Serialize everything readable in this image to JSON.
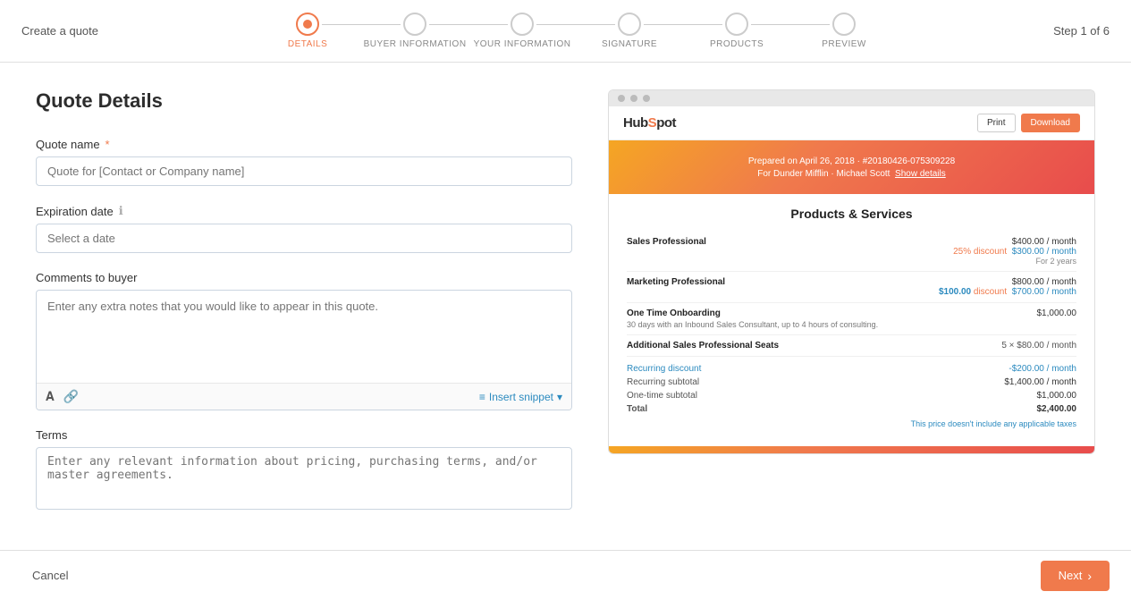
{
  "header": {
    "create_quote_label": "Create a quote",
    "step_info": "Step 1 of 6",
    "steps": [
      {
        "id": "details",
        "label": "DETAILS",
        "active": true
      },
      {
        "id": "buyer-information",
        "label": "BUYER INFORMATION",
        "active": false
      },
      {
        "id": "your-information",
        "label": "YOUR INFORMATION",
        "active": false
      },
      {
        "id": "signature",
        "label": "SIGNATURE",
        "active": false
      },
      {
        "id": "products",
        "label": "PRODUCTS",
        "active": false
      },
      {
        "id": "preview",
        "label": "PREVIEW",
        "active": false
      }
    ]
  },
  "form": {
    "title": "Quote Details",
    "quote_name": {
      "label": "Quote name",
      "required": "*",
      "placeholder": "Quote for [Contact or Company name]"
    },
    "expiration_date": {
      "label": "Expiration date",
      "placeholder": "Select a date"
    },
    "comments_to_buyer": {
      "label": "Comments to buyer",
      "placeholder": "Enter any extra notes that you would like to appear in this quote."
    },
    "insert_snippet": "Insert snippet",
    "terms": {
      "label": "Terms",
      "placeholder": "Enter any relevant information about pricing, purchasing terms, and/or master agreements."
    }
  },
  "preview": {
    "logo": "HubSpot",
    "print_btn": "Print",
    "download_btn": "Download",
    "banner_date": "Prepared on April 26, 2018 · #20180426-075309228",
    "banner_company": "For Dunder Mifflin · Michael Scott",
    "banner_link": "Show details",
    "products_title": "Products & Services",
    "products": [
      {
        "name": "Sales Professional",
        "price_original": "$400.00 / month",
        "discount_label": "25% discount",
        "price_discounted": "$300.00 / month",
        "note": "For 2 years"
      },
      {
        "name": "Marketing Professional",
        "price_original": "$800.00 / month",
        "discount_label": "$100.00 discount",
        "price_discounted": "$700.00 / month",
        "note": ""
      },
      {
        "name": "One Time Onboarding",
        "price_original": "$1,000.00",
        "desc": "30 days with an Inbound Sales Consultant, up to 4 hours of consulting."
      },
      {
        "name": "Additional Sales Professional Seats",
        "qty": "5 × $80.00 / month"
      }
    ],
    "summary": {
      "recurring_discount_label": "Recurring discount",
      "recurring_discount_value": "-$200.00 / month",
      "recurring_subtotal_label": "Recurring subtotal",
      "recurring_subtotal_value": "$1,400.00 / month",
      "onetime_subtotal_label": "One-time subtotal",
      "onetime_subtotal_value": "$1,000.00",
      "total_label": "Total",
      "total_value": "$2,400.00",
      "tax_note": "This price doesn't include any applicable taxes"
    }
  },
  "footer": {
    "cancel_label": "Cancel",
    "next_label": "Next"
  }
}
